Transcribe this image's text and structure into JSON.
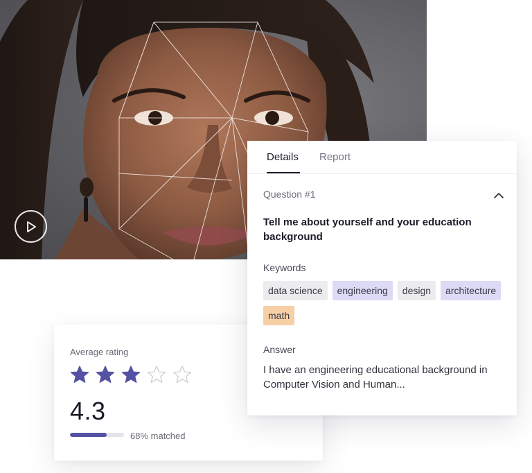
{
  "video": {
    "play_icon": "play-circle-icon"
  },
  "rating": {
    "label": "Average rating",
    "value": "4.3",
    "stars_filled": 3,
    "stars_total": 5,
    "star_color": "#5552a3",
    "match_fraction": 0.68,
    "match_text": "68% matched"
  },
  "panel": {
    "tabs": [
      {
        "label": "Details",
        "active": true
      },
      {
        "label": "Report",
        "active": false
      }
    ],
    "question_label": "Question #1",
    "collapse_icon": "chevron-up-icon",
    "question_title": "Tell me about yourself and your education background",
    "keywords_label": "Keywords",
    "keywords": [
      {
        "label": "data science",
        "color": "#ececef"
      },
      {
        "label": "engineering",
        "color": "#dcdaf4"
      },
      {
        "label": "design",
        "color": "#ececef"
      },
      {
        "label": "architecture",
        "color": "#dcdaf4"
      },
      {
        "label": "math",
        "color": "#f7cfa5"
      }
    ],
    "answer_label": "Answer",
    "answer_text": "I have an engineering educational background in Computer Vision and Human..."
  }
}
